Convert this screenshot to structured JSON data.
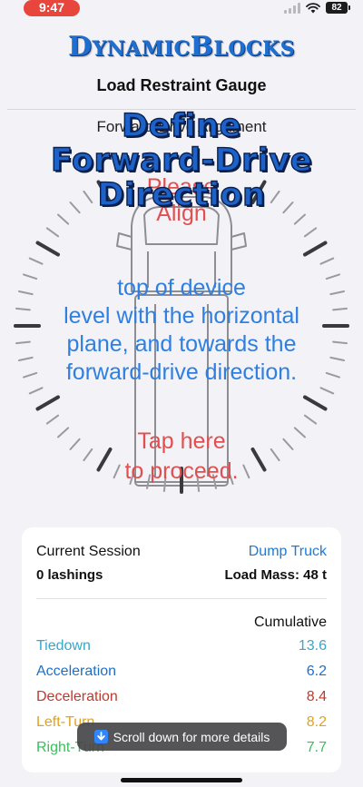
{
  "status_bar": {
    "time": "9:47",
    "battery": "82"
  },
  "header": {
    "brand_first": "D",
    "brand_first_rest": "YNAMIC",
    "brand_second": "B",
    "brand_second_rest": "LOCKS",
    "subtitle": "Load Restraint Gauge",
    "section_label": "Forward-Drive Alignment"
  },
  "overlay": {
    "title_line1": "Define",
    "title_line2": "Forward-Drive",
    "title_line3": "Direction",
    "please_line1": "Please",
    "please_line2": "Align",
    "instruction_line1": "top of device",
    "instruction_line2": "level with the horizontal",
    "instruction_line3": "plane, and towards the",
    "instruction_line4": "forward-drive direction.",
    "proceed_line1": "Tap here",
    "proceed_line2": "to proceed."
  },
  "session": {
    "title": "Current Session",
    "vehicle": "Dump Truck",
    "lashings": "0 lashings",
    "load_mass": "Load Mass: 48 t",
    "cumulative_label": "Cumulative",
    "metrics": [
      {
        "label": "Tiedown",
        "value": "13.6",
        "color": "#3aa6c9"
      },
      {
        "label": "Acceleration",
        "value": "6.2",
        "color": "#1e6fc8"
      },
      {
        "label": "Deceleration",
        "value": "8.4",
        "color": "#c0392b"
      },
      {
        "label": "Left-Turn",
        "value": "8.2",
        "color": "#e0a21f"
      },
      {
        "label": "Right-Turn",
        "value": "7.7",
        "color": "#35c25a"
      }
    ]
  },
  "toast": {
    "label": "Scroll down for more details",
    "icon": "down-arrow-icon"
  },
  "colors": {
    "accent": "#1f7ad6",
    "warning_red": "#e05050",
    "instruction_blue": "#2f7fe0"
  }
}
